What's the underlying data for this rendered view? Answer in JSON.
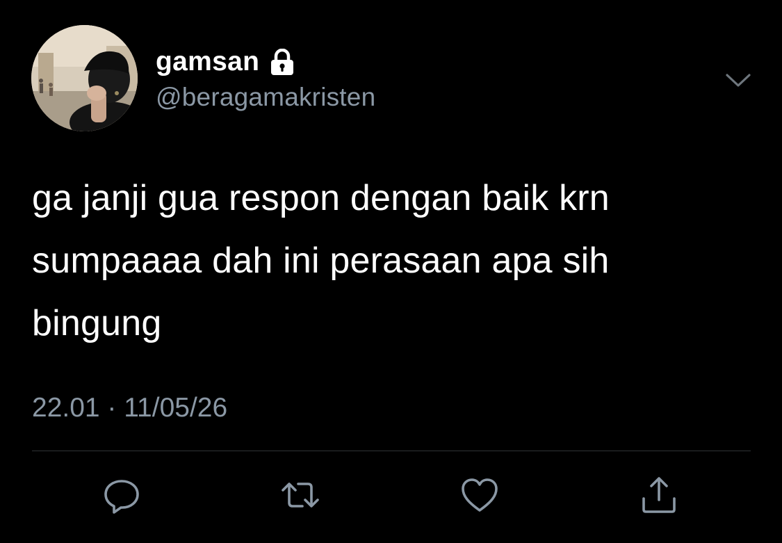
{
  "user": {
    "display_name": "gamsan",
    "handle": "@beragamakristen",
    "protected_icon": "lock-icon",
    "avatar_icon": "profile-photo"
  },
  "tweet": {
    "text": "ga janji gua respon dengan baik krn\nsumpaaaa dah ini perasaan apa sih\nbingung",
    "timestamp": "22.01 · 11/05/26"
  },
  "menu": {
    "icon": "chevron-down-icon"
  },
  "actions": [
    {
      "icon": "reply-icon"
    },
    {
      "icon": "retweet-icon"
    },
    {
      "icon": "like-icon"
    },
    {
      "icon": "share-icon"
    }
  ],
  "colors": {
    "background": "#000000",
    "primary_text": "#ffffff",
    "secondary_text": "#8b98a5",
    "divider": "#2f3336"
  }
}
